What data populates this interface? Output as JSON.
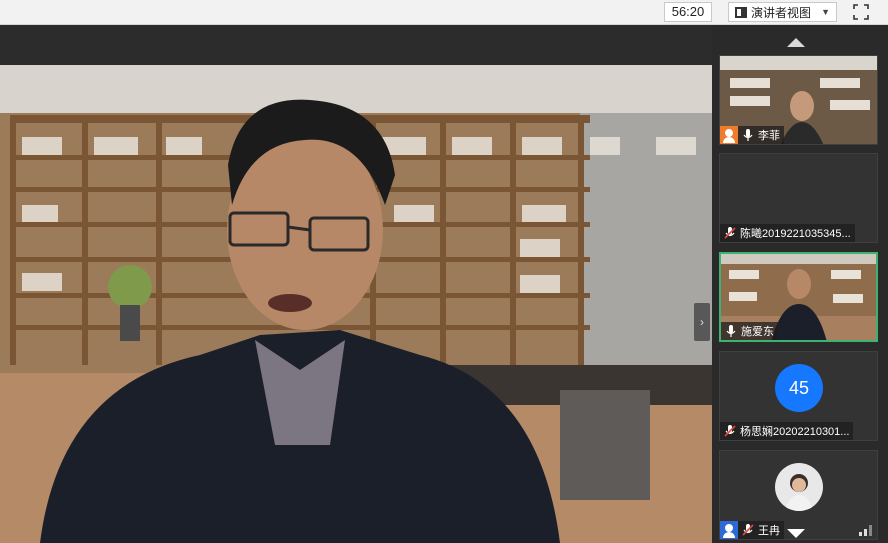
{
  "toolbar": {
    "timer": "56:20",
    "presenter_view_label": "演讲者视图",
    "presenter_view_caret": "▼"
  },
  "main": {
    "next_arrow": "›"
  },
  "participants": [
    {
      "name": "李菲",
      "muted": false,
      "has_video": true,
      "role_badge": true
    },
    {
      "name": "陈曦2019221035345...",
      "muted": true,
      "has_video": false
    },
    {
      "name": "施爱东",
      "muted": false,
      "has_video": true,
      "active": true
    },
    {
      "name": "杨思娴20202210301...",
      "muted": true,
      "has_video": false,
      "avatar_text": "45"
    },
    {
      "name": "王冉",
      "muted": true,
      "has_video": false,
      "role_badge": true
    }
  ],
  "colors": {
    "active_border": "#3cb371",
    "avatar_bg": "#1677ff",
    "muted_icon": "#e04a3c",
    "badge_orange": "#f07b2a",
    "badge_blue": "#2d6ad8"
  }
}
